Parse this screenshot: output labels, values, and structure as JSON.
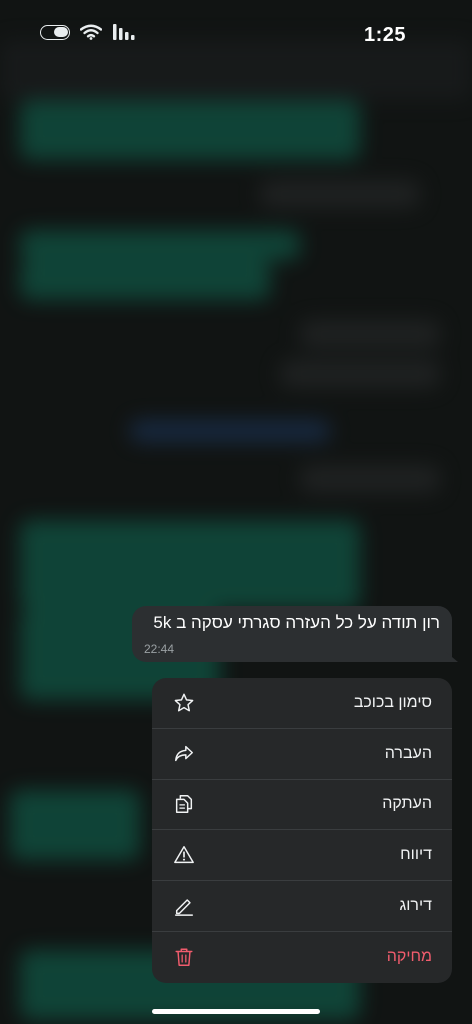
{
  "status_bar": {
    "time": "1:25",
    "icons": [
      "toggle-icon",
      "wifi-icon",
      "signal-icon"
    ]
  },
  "message": {
    "text": "רון תודה על כל העזרה סגרתי עסקה ב 5k",
    "time": "22:44"
  },
  "context_menu": {
    "items": [
      {
        "label": "סימון בכוכב",
        "icon": "star-icon"
      },
      {
        "label": "העברה",
        "icon": "forward-icon"
      },
      {
        "label": "העתקה",
        "icon": "copy-icon"
      },
      {
        "label": "דיווח",
        "icon": "warning-icon"
      },
      {
        "label": "דירוג",
        "icon": "pencil-icon"
      },
      {
        "label": "מחיקה",
        "icon": "trash-icon"
      }
    ]
  },
  "colors": {
    "background": "#111413",
    "bubble": "#2c2f31",
    "menu": "#262829",
    "danger": "#f15c6d",
    "chat_green": "#0f6b55"
  }
}
